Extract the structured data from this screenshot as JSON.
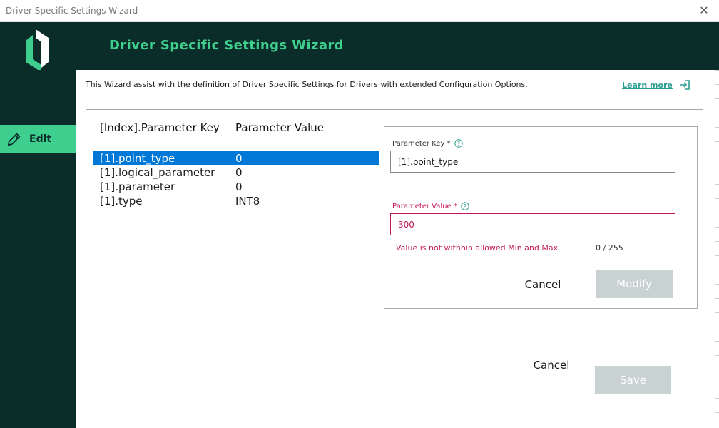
{
  "window": {
    "title": "Driver Specific Settings Wizard",
    "close_glyph": "✕"
  },
  "header": {
    "title": "Driver Specific Settings Wizard",
    "logo_icon": "brand-logo-icon"
  },
  "sidebar": {
    "items": [
      {
        "label": "Edit",
        "icon": "pencil-icon",
        "active": true
      }
    ]
  },
  "intro": {
    "text": "This Wizard assist with the definition of Driver Specific Settings for Drivers with extended Configuration Options.",
    "learn_more": "Learn more",
    "learn_more_icon": "external-link-icon"
  },
  "table": {
    "columns": [
      "[Index].Parameter Key",
      "Parameter Value"
    ],
    "rows": [
      {
        "key": "[1].point_type",
        "value": "0",
        "selected": true
      },
      {
        "key": "[1].logical_parameter",
        "value": "0",
        "selected": false
      },
      {
        "key": "[1].parameter",
        "value": "0",
        "selected": false
      },
      {
        "key": "[1].type",
        "value": "INT8",
        "selected": false
      }
    ]
  },
  "editor": {
    "key_label": "Parameter Key *",
    "key_value": "[1].point_type",
    "value_label": "Parameter Value *",
    "value_value": "300",
    "error": "Value is not withhin allowed Min and Max.",
    "counter": "0 / 255",
    "cancel": "Cancel",
    "modify": "Modify"
  },
  "footer": {
    "cancel": "Cancel",
    "save": "Save"
  },
  "colors": {
    "background": "#0a2d2a",
    "accent": "#3ecf8e",
    "selection": "#0078d7",
    "error": "#c2185b",
    "disabled_button": "#c8d2d2",
    "link": "#2a9d8f"
  }
}
